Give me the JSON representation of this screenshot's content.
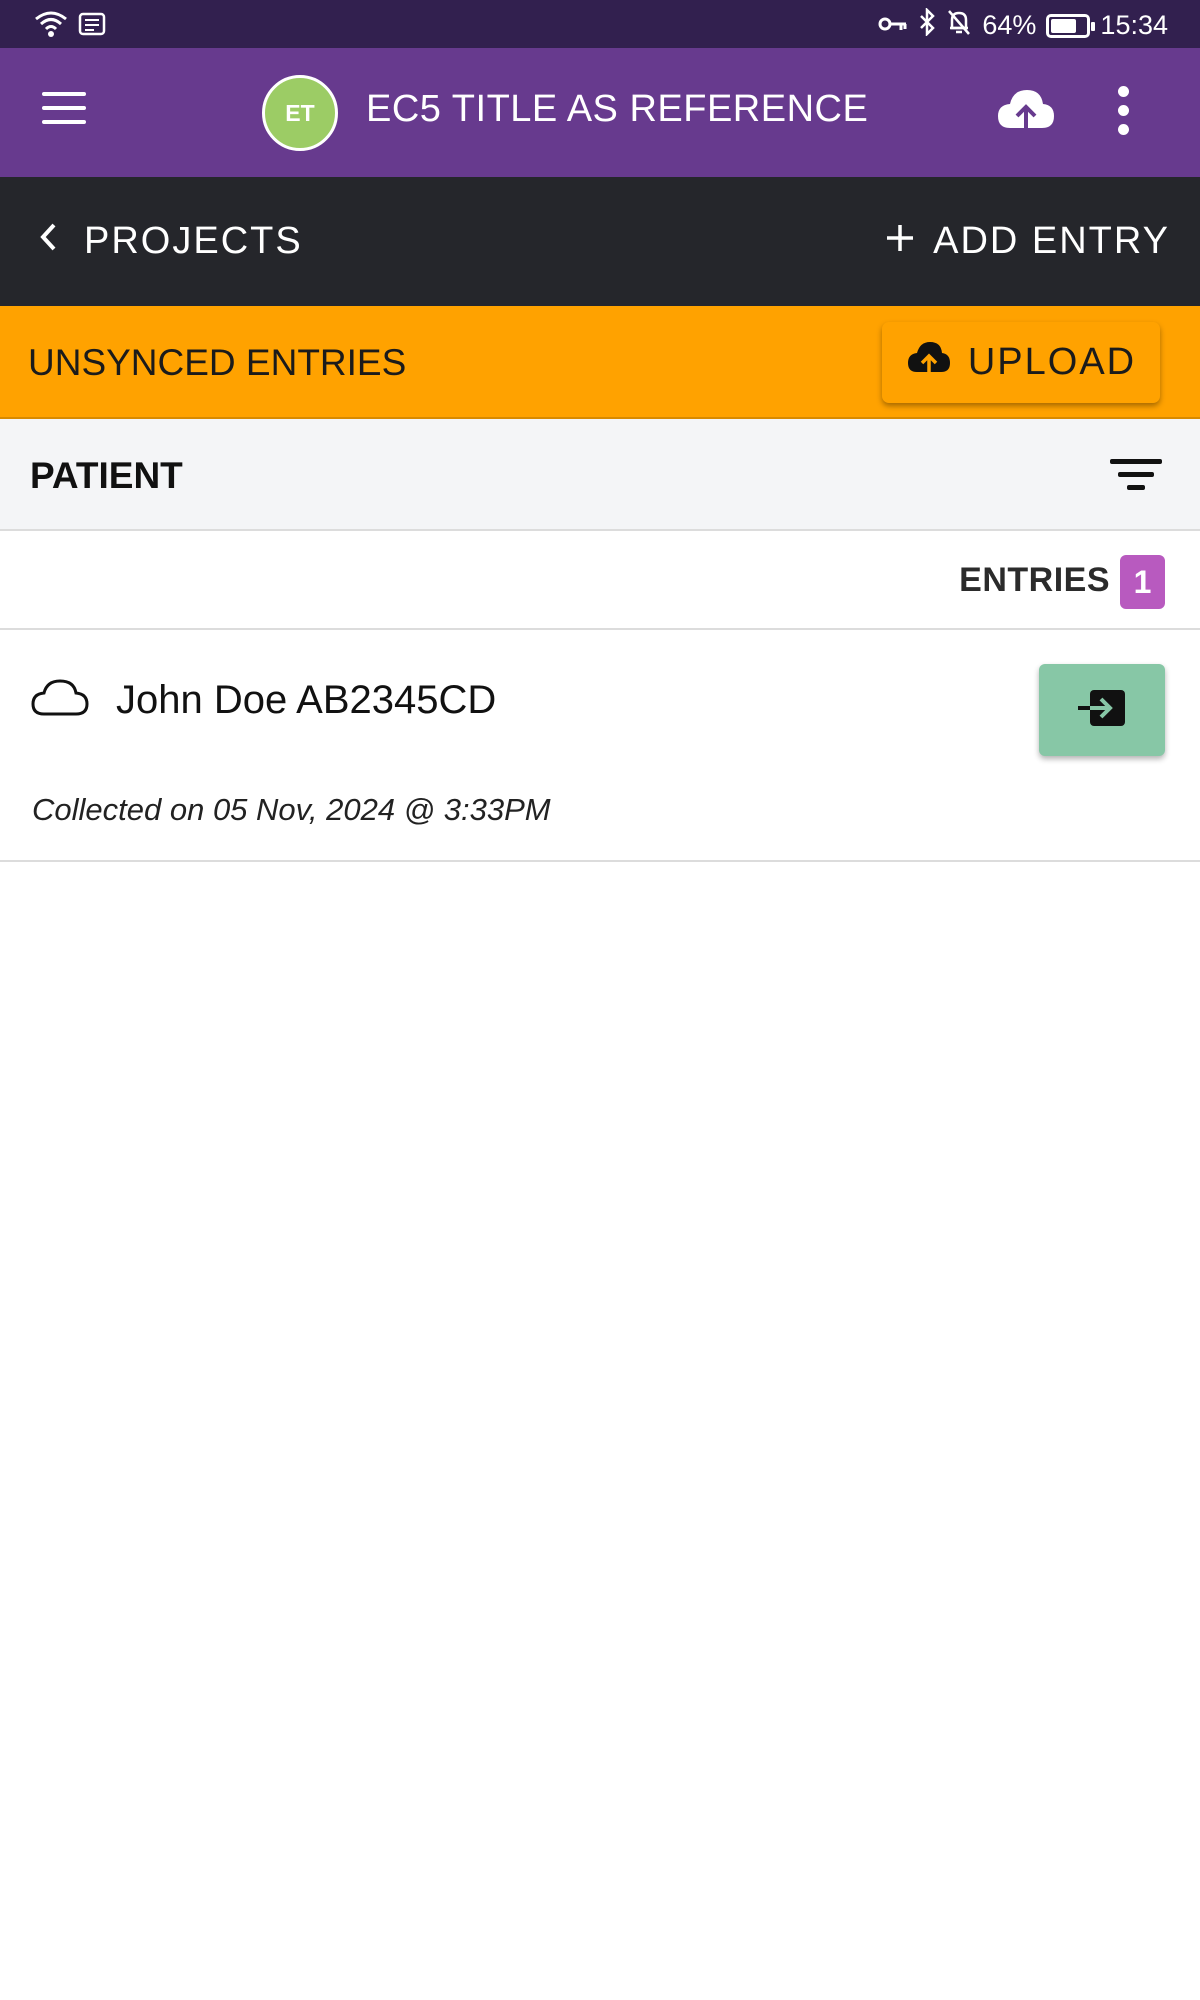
{
  "status_bar": {
    "battery_percent": "64%",
    "time": "15:34",
    "battery_level": 0.64,
    "icons": [
      "wifi-icon",
      "data-icon",
      "vpn-key-icon",
      "bluetooth-icon",
      "mute-bell-icon",
      "battery-icon"
    ]
  },
  "app_bar": {
    "avatar_initials": "ET",
    "title": "EC5 TITLE AS REFERENCE",
    "menu_icon": "hamburger-menu-icon",
    "upload_icon": "cloud-upload-icon",
    "more_icon": "more-vert-icon"
  },
  "nav_bar": {
    "back_label": "PROJECTS",
    "add_entry_label": "ADD ENTRY"
  },
  "unsynced_bar": {
    "label": "UNSYNCED ENTRIES",
    "upload_label": "UPLOAD",
    "color": "#ffa200"
  },
  "form_header": {
    "form_name": "PATIENT",
    "filter_icon": "filter-icon"
  },
  "entries": {
    "label": "ENTRIES",
    "count": "1",
    "badge_color": "#b85abf",
    "items": [
      {
        "title": "John Doe AB2345CD",
        "collected": "Collected on 05 Nov, 2024 @ 3:33PM",
        "sync_icon": "cloud-icon",
        "open_icon": "open-entry-icon"
      }
    ]
  },
  "colors": {
    "status_bar": "#32204f",
    "app_bar": "#673a8e",
    "nav_bar": "#25262b",
    "open_button": "#87c7a6",
    "avatar": "#9ccc65"
  }
}
